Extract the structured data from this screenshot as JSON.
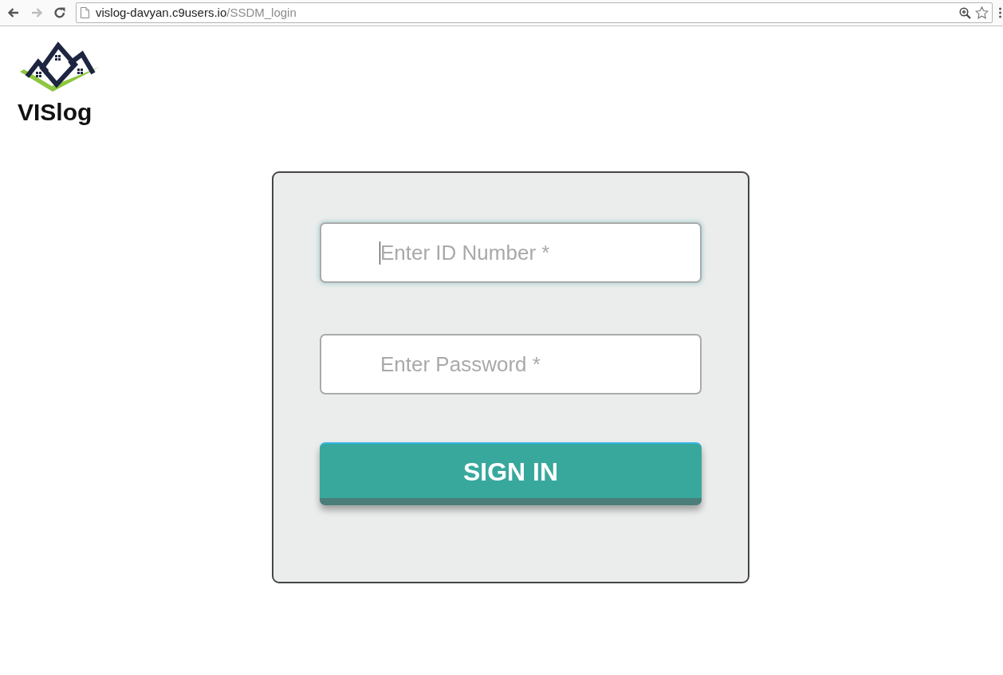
{
  "browser": {
    "nav_buttons": [
      {
        "kind": "back",
        "disabled": false
      },
      {
        "kind": "forward",
        "disabled": true
      },
      {
        "kind": "reload",
        "disabled": false
      }
    ],
    "address_bar": {
      "host": "vislog-davyan.c9users.io",
      "path": "/SSDM_login"
    }
  },
  "logo": {
    "text": "VISlog"
  },
  "login_form": {
    "fields": [
      {
        "placeholder": "Enter ID Number *",
        "focused": true
      },
      {
        "placeholder": "Enter Password *",
        "focused": false
      }
    ],
    "submit_button": {
      "label": "SIGN IN"
    }
  }
}
